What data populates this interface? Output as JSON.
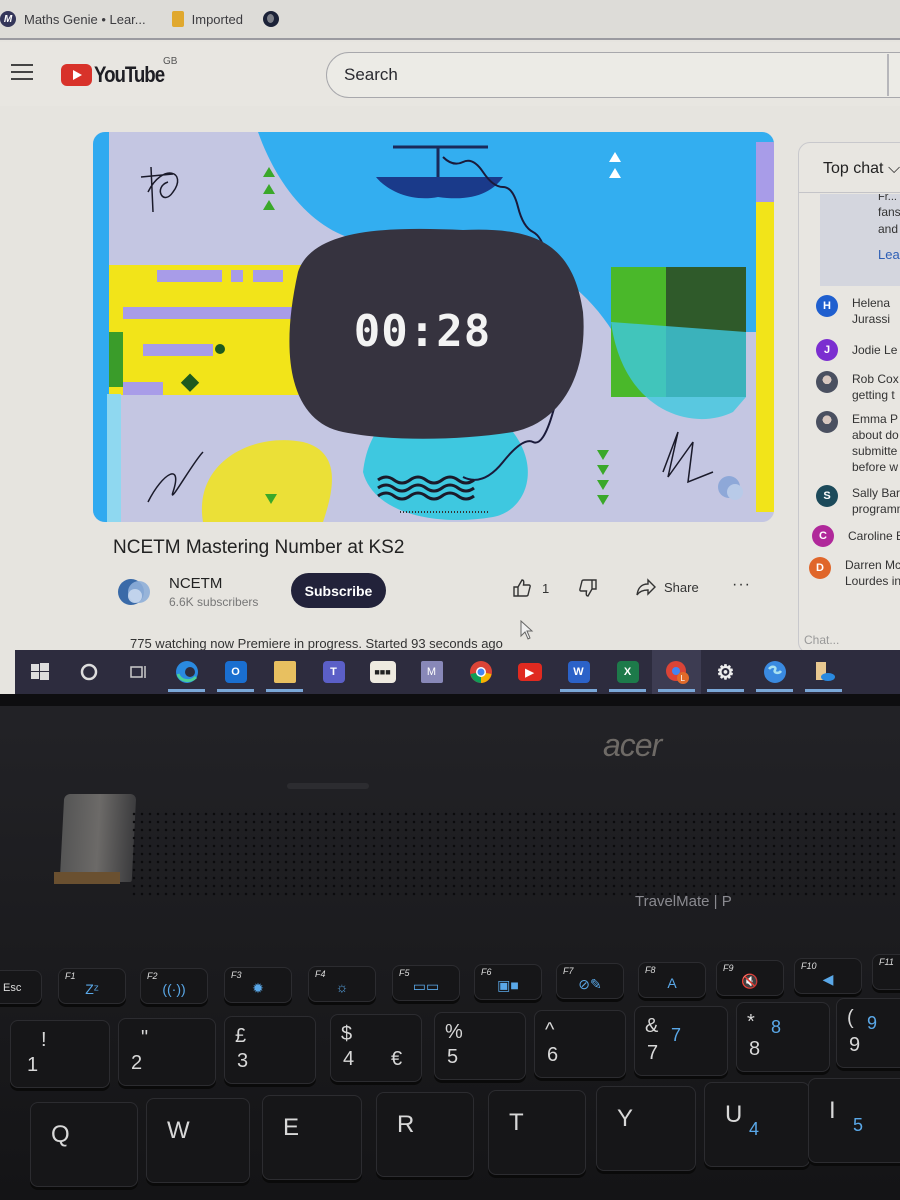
{
  "browser": {
    "bookmarks": [
      {
        "label": "Maths Genie • Lear...",
        "icon": "maths-genie-icon"
      },
      {
        "label": "Imported",
        "icon": "folder-icon"
      },
      {
        "label": "",
        "icon": "globe-icon"
      }
    ]
  },
  "youtube": {
    "logo_text": "YouTube",
    "region": "GB",
    "search_placeholder": "Search"
  },
  "video": {
    "countdown": "00:28",
    "title": "NCETM Mastering Number at KS2",
    "channel": {
      "name": "NCETM",
      "subscribers": "6.6K subscribers"
    },
    "subscribe_label": "Subscribe",
    "likes": "1",
    "share_label": "Share",
    "more_label": "···",
    "status": "775 watching now  Premiere in progress. Started 93 seconds ago",
    "colors": {
      "sky": "#33aef0",
      "yellow": "#f2e419",
      "lavender": "#a89ce8",
      "green": "#3aa82a",
      "blob": "#36333f"
    }
  },
  "chat": {
    "header": "Top chat",
    "banner_lines": [
      "Fr...",
      "fans",
      "and"
    ],
    "banner_link": "Lear",
    "messages": [
      {
        "initial": "H",
        "color": "#1f5fcf",
        "lines": [
          "Helena",
          "Jurassi"
        ]
      },
      {
        "initial": "J",
        "color": "#7b2ed0",
        "lines": [
          "Jodie Le"
        ]
      },
      {
        "initial": "",
        "color": "photo",
        "lines": [
          "Rob Cox",
          "getting t"
        ]
      },
      {
        "initial": "",
        "color": "photo",
        "lines": [
          "Emma P",
          "about do",
          "submitte",
          "before w"
        ]
      },
      {
        "initial": "S",
        "color": "#1c4a5a",
        "lines": [
          "Sally Barl",
          "programm"
        ]
      },
      {
        "initial": "C",
        "color": "#b0289a",
        "lines": [
          "Caroline E"
        ]
      },
      {
        "initial": "D",
        "color": "#e0662a",
        "lines": [
          "Darren Mc",
          "Lourdes in"
        ]
      }
    ],
    "input_placeholder": "Chat..."
  },
  "taskbar": {
    "items": [
      {
        "name": "start",
        "icon": "windows-icon"
      },
      {
        "name": "cortana",
        "icon": "cortana-icon"
      },
      {
        "name": "task-view",
        "icon": "task-view-icon"
      },
      {
        "name": "edge",
        "icon": "edge-icon",
        "open": true
      },
      {
        "name": "outlook",
        "icon": "outlook-icon",
        "label": "O",
        "open": true
      },
      {
        "name": "file-explorer",
        "icon": "folder-icon",
        "open": true
      },
      {
        "name": "teams",
        "icon": "teams-icon",
        "label": "T"
      },
      {
        "name": "app-dots",
        "icon": "dots-app-icon"
      },
      {
        "name": "m-app",
        "icon": "m-app-icon",
        "label": "M"
      },
      {
        "name": "chrome",
        "icon": "chrome-icon"
      },
      {
        "name": "youtube",
        "icon": "youtube-icon"
      },
      {
        "name": "word",
        "icon": "word-icon",
        "label": "W",
        "open": true
      },
      {
        "name": "excel",
        "icon": "excel-icon",
        "label": "X",
        "open": true
      },
      {
        "name": "chrome-profile",
        "icon": "chrome-profile-icon",
        "active": true
      },
      {
        "name": "settings",
        "icon": "gear-icon",
        "label": "⚙",
        "open": true
      },
      {
        "name": "globe-app",
        "icon": "globe-icon",
        "open": true
      },
      {
        "name": "onedrive-files",
        "icon": "onedrive-icon",
        "open": true
      }
    ]
  },
  "laptop": {
    "brand": "acer",
    "model": "TravelMate | P",
    "fkeys": [
      {
        "label": "Esc",
        "glyph": ""
      },
      {
        "label": "F1",
        "glyph": "Zᶻ"
      },
      {
        "label": "F2",
        "glyph": "((·))"
      },
      {
        "label": "F3",
        "glyph": "✹"
      },
      {
        "label": "F4",
        "glyph": "☼"
      },
      {
        "label": "F5",
        "glyph": "▭▭"
      },
      {
        "label": "F6",
        "glyph": "▣■"
      },
      {
        "label": "F7",
        "glyph": "⊘✎"
      },
      {
        "label": "F8",
        "glyph": "A"
      },
      {
        "label": "F9",
        "glyph": "🔇"
      },
      {
        "label": "F10",
        "glyph": "◀"
      },
      {
        "label": "F11",
        "glyph": ""
      }
    ],
    "number_keys": [
      {
        "top": "!",
        "bottom": "1",
        "alt": ""
      },
      {
        "top": "\"",
        "bottom": "2",
        "alt": ""
      },
      {
        "top": "£",
        "bottom": "3",
        "alt": ""
      },
      {
        "top": "$",
        "bottom": "4",
        "alt": "€"
      },
      {
        "top": "%",
        "bottom": "5",
        "alt": ""
      },
      {
        "top": "^",
        "bottom": "6",
        "alt": ""
      },
      {
        "top": "&",
        "bottom": "7",
        "alt": "7"
      },
      {
        "top": "*",
        "bottom": "8",
        "alt": "8"
      },
      {
        "top": "(",
        "bottom": "9",
        "alt": "9"
      }
    ],
    "letter_keys": [
      {
        "letter": "Q",
        "alt": ""
      },
      {
        "letter": "W",
        "alt": ""
      },
      {
        "letter": "E",
        "alt": ""
      },
      {
        "letter": "R",
        "alt": ""
      },
      {
        "letter": "T",
        "alt": ""
      },
      {
        "letter": "Y",
        "alt": ""
      },
      {
        "letter": "U",
        "alt": "4"
      },
      {
        "letter": "I",
        "alt": "5"
      }
    ]
  }
}
